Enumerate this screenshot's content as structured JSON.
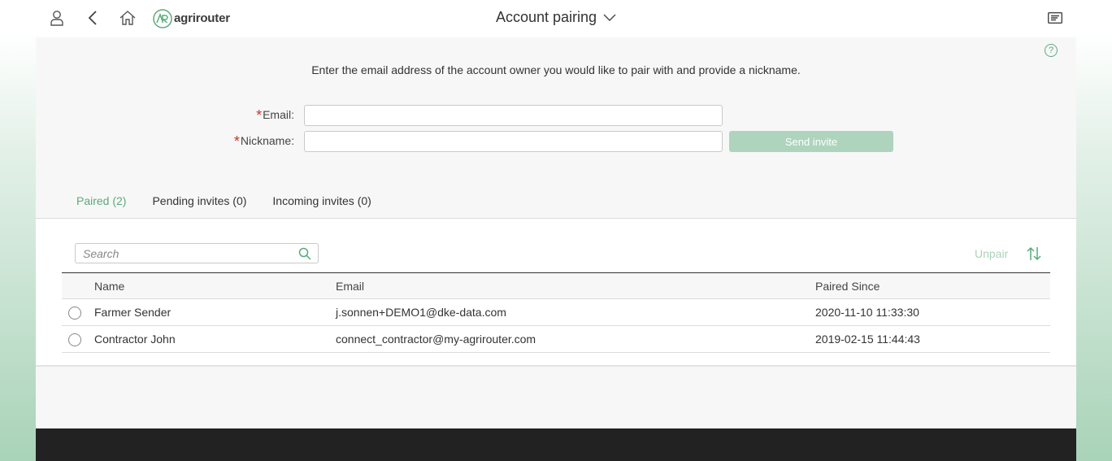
{
  "header": {
    "title": "Account pairing",
    "logo_text": "agrirouter",
    "icons": {
      "user": "user-icon",
      "back": "back-arrow-icon",
      "home": "home-icon",
      "title_dropdown": "chevron-down-icon",
      "menu": "menu-icon"
    }
  },
  "form": {
    "help_icon": "?",
    "intro": "Enter the email address of the account owner you would like to pair with and provide a nickname.",
    "required_mark": "*",
    "email_label": "Email:",
    "email_value": "",
    "nickname_label": "Nickname:",
    "nickname_value": "",
    "send_button": "Send invite"
  },
  "tabs": [
    {
      "label": "Paired (2)",
      "active": true
    },
    {
      "label": "Pending invites (0)",
      "active": false
    },
    {
      "label": "Incoming invites (0)",
      "active": false
    }
  ],
  "list": {
    "search_placeholder": "Search",
    "unpair_label": "Unpair",
    "columns": [
      "Name",
      "Email",
      "Paired Since"
    ],
    "rows": [
      {
        "name": "Farmer Sender",
        "email": "j.sonnen+DEMO1@dke-data.com",
        "paired_since": "2020-11-10 11:33:30"
      },
      {
        "name": "Contractor John",
        "email": "connect_contractor@my-agrirouter.com",
        "paired_since": "2019-02-15 11:44:43"
      }
    ]
  },
  "colors": {
    "accent": "#5aaa7c",
    "button_disabled": "#aed4bd",
    "footer": "#222222",
    "required": "#c0392b"
  }
}
